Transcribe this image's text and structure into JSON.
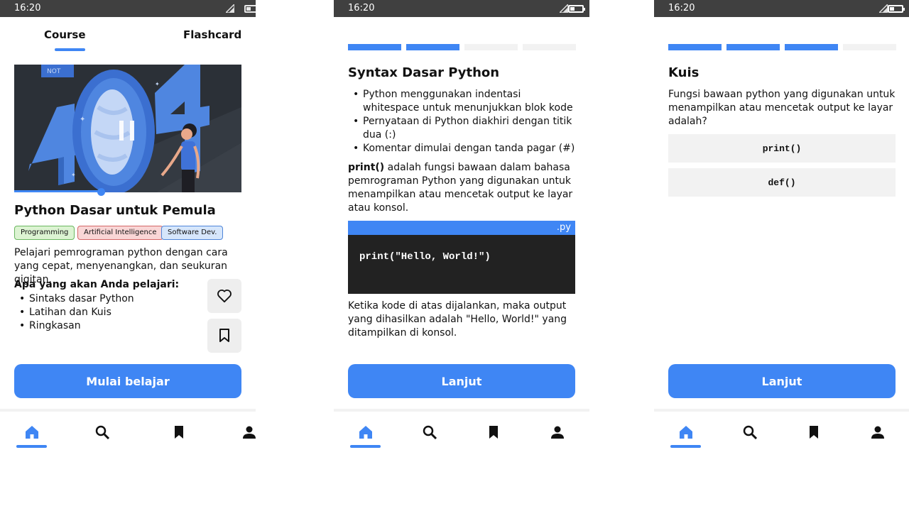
{
  "status": {
    "time": "16:20"
  },
  "course": {
    "tabs": [
      "Course",
      "Flashcard"
    ],
    "video_progress": 0.38,
    "title": "Python Dasar untuk Pemula",
    "tags": [
      "Programming",
      "Artificial Intelligence",
      "Software Dev."
    ],
    "description": "Pelajari pemrograman python dengan cara yang cepat, menyenangkan, dan seukuran gigitan.",
    "learn_heading": "Apa yang akan Anda pelajari:",
    "learn_items": [
      "Sintaks dasar Python",
      "Latihan dan Kuis",
      "Ringkasan"
    ],
    "start_button": "Mulai belajar"
  },
  "lesson": {
    "progress_filled": 2,
    "progress_total": 4,
    "title": "Syntax Dasar Python",
    "bullets": [
      "Python menggunakan indentasi whitespace untuk menunjukkan blok kode",
      "Pernyataan di Python diakhiri dengan titik dua (:)",
      "Komentar dimulai dengan tanda pagar (#)"
    ],
    "para1_bold": "print()",
    "para1_rest": " adalah fungsi bawaan dalam bahasa pemrograman Python yang digunakan untuk menampilkan atau mencetak output ke layar atau konsol.",
    "code_ext": ".py",
    "code": "print(\"Hello, World!\")",
    "para2": "Ketika kode di atas dijalankan, maka output yang dihasilkan adalah \"Hello, World!\" yang ditampilkan di konsol.",
    "next_button": "Lanjut"
  },
  "quiz": {
    "progress_filled": 3,
    "progress_total": 4,
    "title": "Kuis",
    "question": "Fungsi bawaan python yang digunakan untuk menampilkan atau mencetak output ke layar adalah?",
    "options": [
      "print()",
      "def()"
    ],
    "next_button": "Lanjut"
  },
  "colors": {
    "accent": "#3f86f4",
    "statusbar": "#404040",
    "segment_empty": "#f2f2f2"
  },
  "nav_icons": [
    "home-icon",
    "search-icon",
    "bookmark-icon",
    "profile-icon"
  ]
}
